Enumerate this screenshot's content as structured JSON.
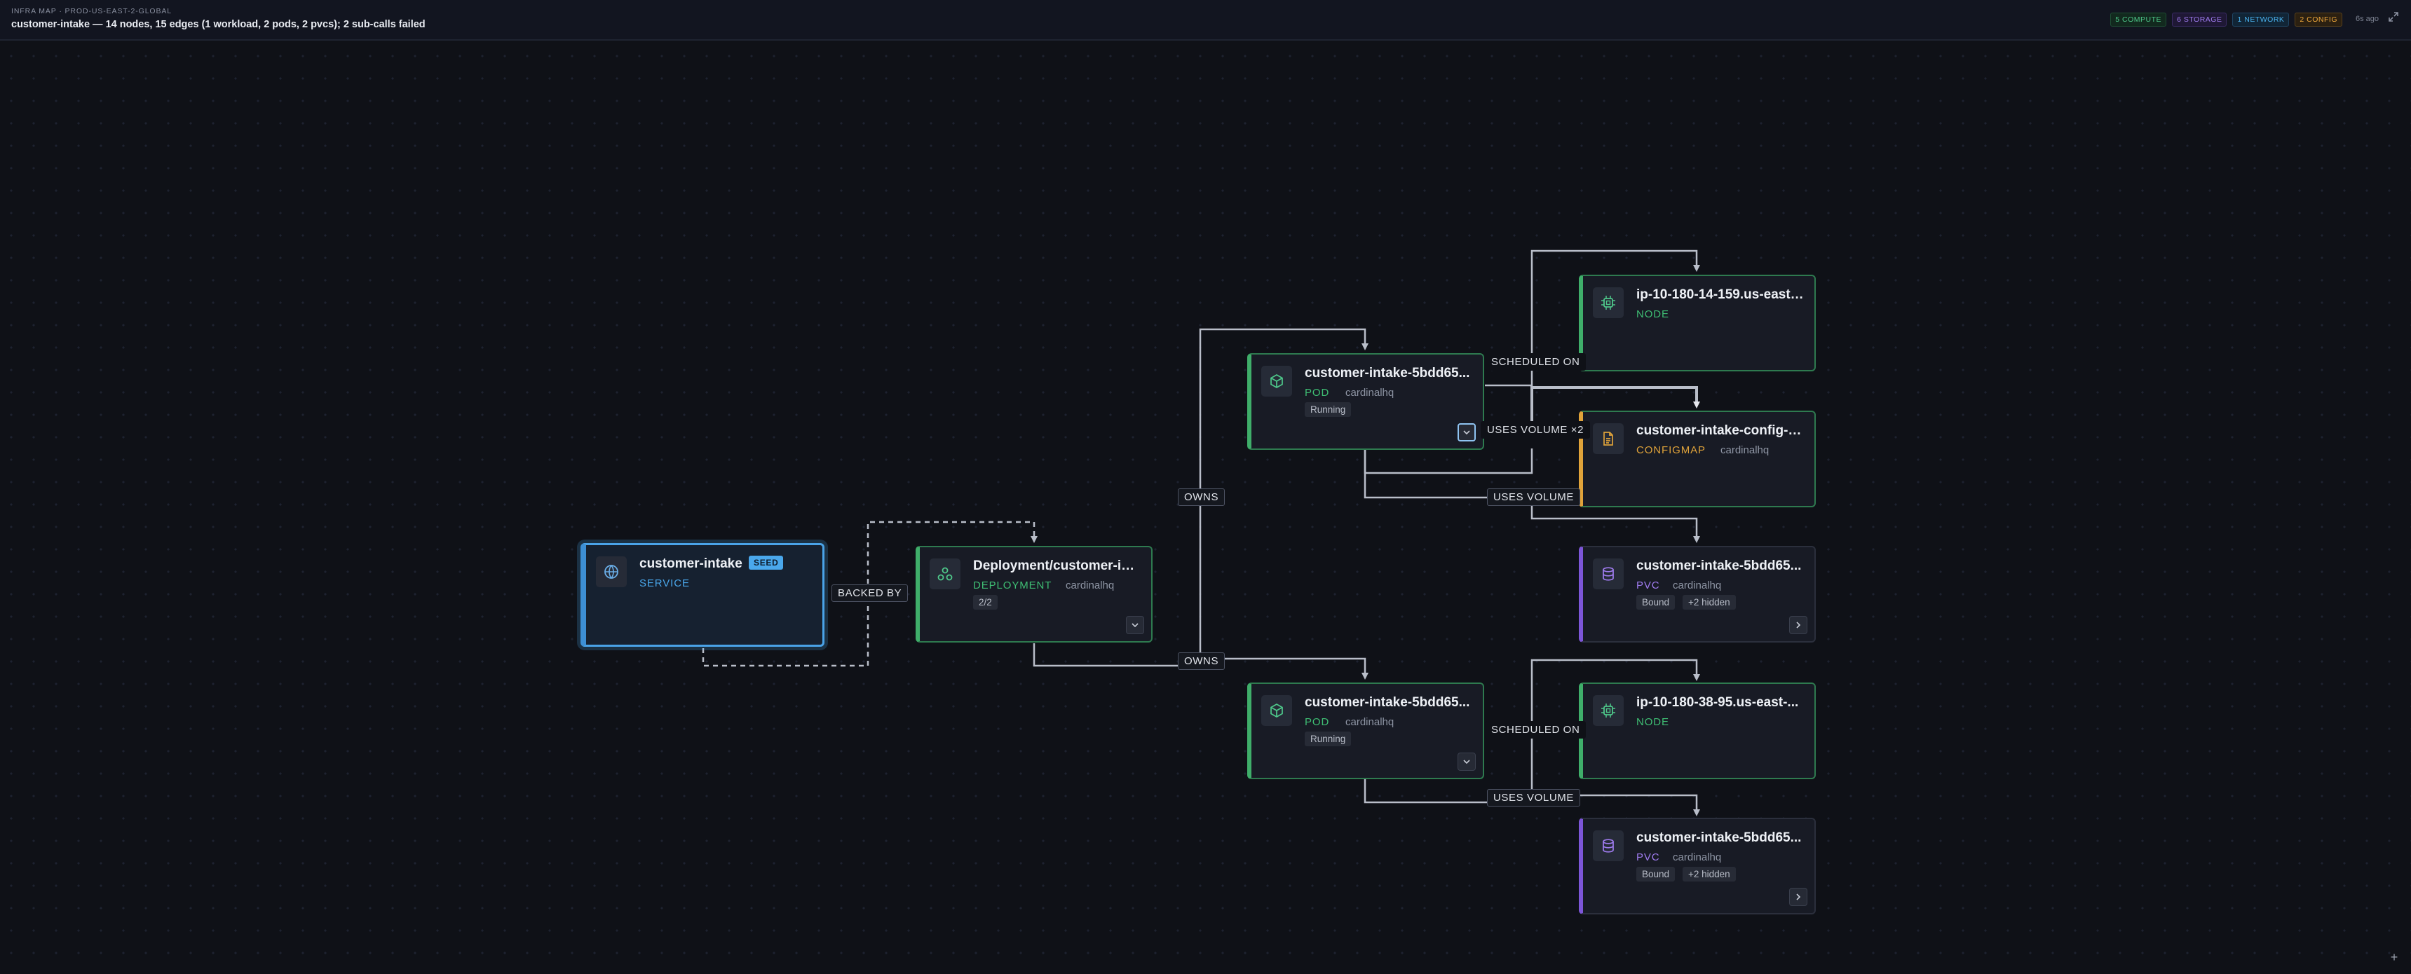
{
  "header": {
    "breadcrumb": "INFRA MAP · PROD-US-EAST-2-GLOBAL",
    "summary": "customer-intake — 14 nodes, 15 edges (1 workload, 2 pods, 2 pvcs); 2 sub-calls failed",
    "badges": {
      "compute": "5 COMPUTE",
      "storage": "6 STORAGE",
      "network": "1 NETWORK",
      "config": "2 CONFIG"
    },
    "age": "6s ago",
    "expand_icon": "expand-icon"
  },
  "colors": {
    "background": "#0f1117",
    "compute": "#3fae6a",
    "storage": "#7d56d8",
    "network": "#4aa3e8",
    "config": "#e0a33a"
  },
  "nodes": {
    "service": {
      "title": "customer-intake",
      "seed": "SEED",
      "kind": "SERVICE",
      "icon": "network-globe-icon"
    },
    "deployment": {
      "title": "Deployment/customer-int...",
      "kind": "DEPLOYMENT",
      "namespace": "cardinalhq",
      "chip": "2/2",
      "icon": "deployment-icon"
    },
    "pod_top": {
      "title": "customer-intake-5bdd65...",
      "kind": "POD",
      "namespace": "cardinalhq",
      "chip": "Running",
      "icon": "pod-cube-icon"
    },
    "pod_bottom": {
      "title": "customer-intake-5bdd65...",
      "kind": "POD",
      "namespace": "cardinalhq",
      "chip": "Running",
      "icon": "pod-cube-icon"
    },
    "node_top": {
      "title": "ip-10-180-14-159.us-east-...",
      "kind": "NODE",
      "icon": "cpu-chip-icon"
    },
    "configmap": {
      "title": "customer-intake-config-2...",
      "kind": "CONFIGMAP",
      "namespace": "cardinalhq",
      "icon": "file-icon"
    },
    "pvc_top": {
      "title": "customer-intake-5bdd65...",
      "kind": "PVC",
      "namespace": "cardinalhq",
      "chip": "Bound",
      "hidden": "+2 hidden",
      "icon": "database-icon"
    },
    "node_bottom": {
      "title": "ip-10-180-38-95.us-east-...",
      "kind": "NODE",
      "icon": "cpu-chip-icon"
    },
    "pvc_bottom": {
      "title": "customer-intake-5bdd65...",
      "kind": "PVC",
      "namespace": "cardinalhq",
      "chip": "Bound",
      "hidden": "+2 hidden",
      "icon": "database-icon"
    }
  },
  "edge_labels": {
    "backed_by": "BACKED BY",
    "owns": "OWNS",
    "scheduled_on": "SCHEDULED ON",
    "uses_volume": "USES VOLUME",
    "uses_volume_multi": "USES VOLUME ×2"
  },
  "controls": {
    "zoom_in": "+"
  }
}
